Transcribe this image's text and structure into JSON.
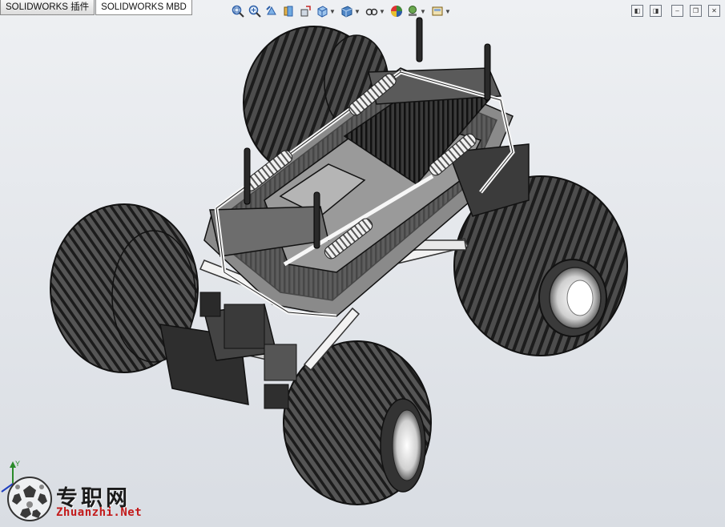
{
  "tabs": [
    {
      "label": "SOLIDWORKS 插件",
      "active": false
    },
    {
      "label": "SOLIDWORKS MBD",
      "active": true
    }
  ],
  "toolbar": {
    "icons": [
      "zoom-to-fit-icon",
      "zoom-area-icon",
      "previous-view-icon",
      "section-view-icon",
      "dynamic-annotation-icon",
      "view-orientation-icon",
      "display-style-icon",
      "hide-show-items-icon",
      "edit-appearance-icon",
      "apply-scene-icon",
      "view-settings-icon"
    ]
  },
  "watermark": {
    "brand_cn": "专职网",
    "brand_en": "Zhuanzhi.Net"
  },
  "triad": {
    "y_label": "Y"
  },
  "colors": {
    "accent_red": "#c31b1b",
    "background": "#e4e7eb",
    "model_dark": "#2a2a2a"
  }
}
